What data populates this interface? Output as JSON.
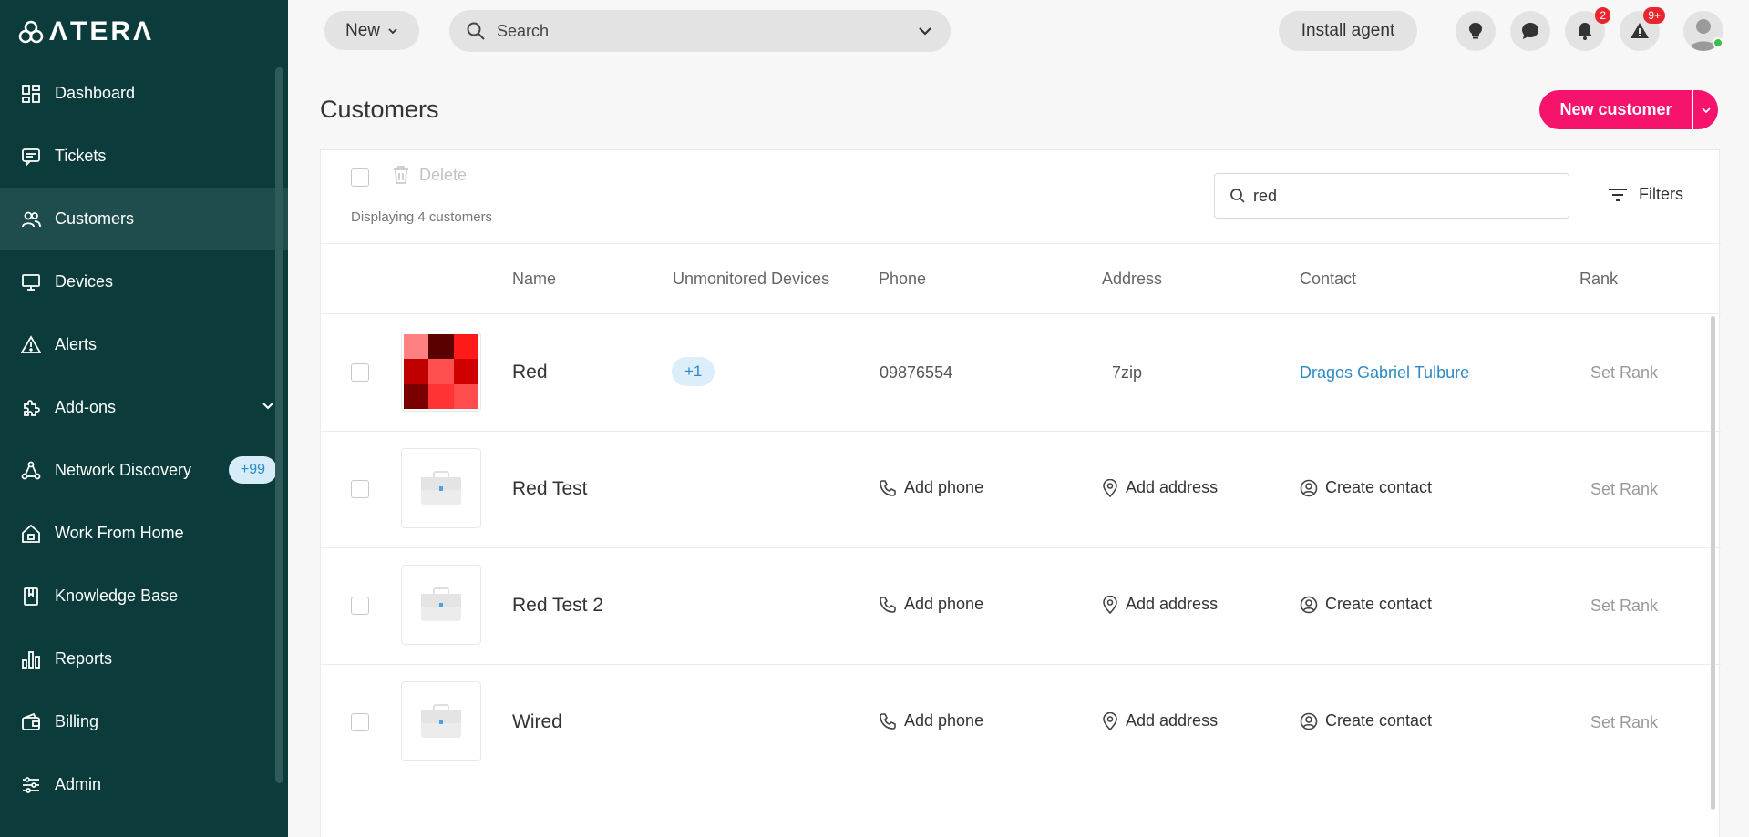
{
  "brand": {
    "logo_text": "ΛTERΛ"
  },
  "sidebar": {
    "items": [
      {
        "label": "Dashboard",
        "icon": "dashboard-icon"
      },
      {
        "label": "Tickets",
        "icon": "ticket-icon"
      },
      {
        "label": "Customers",
        "icon": "customers-icon",
        "active": true
      },
      {
        "label": "Devices",
        "icon": "monitor-icon"
      },
      {
        "label": "Alerts",
        "icon": "alert-icon"
      },
      {
        "label": "Add-ons",
        "icon": "puzzle-icon",
        "expandable": true
      },
      {
        "label": "Network Discovery",
        "icon": "network-icon",
        "badge": "+99"
      },
      {
        "label": "Work From Home",
        "icon": "home-icon"
      },
      {
        "label": "Knowledge Base",
        "icon": "book-icon"
      },
      {
        "label": "Reports",
        "icon": "bar-chart-icon"
      },
      {
        "label": "Billing",
        "icon": "wallet-icon"
      },
      {
        "label": "Admin",
        "icon": "sliders-icon"
      }
    ]
  },
  "topbar": {
    "new_label": "New",
    "search_label": "Search",
    "install_label": "Install agent",
    "notifications_count": "2",
    "alerts_count": "9+"
  },
  "page": {
    "title": "Customers",
    "new_customer_label": "New customer"
  },
  "toolbar": {
    "delete_label": "Delete",
    "displaying_text": "Displaying 4 customers",
    "search_value": "red",
    "filters_label": "Filters"
  },
  "table": {
    "columns": [
      "Name",
      "Unmonitored Devices",
      "Phone",
      "Address",
      "Contact",
      "Rank"
    ],
    "rows": [
      {
        "name": "Red",
        "unmonitored": "+1",
        "phone": "09876554",
        "address": "7zip",
        "contact": "Dragos Gabriel Tulbure",
        "rank": "Set Rank",
        "has_logo": true
      },
      {
        "name": "Red Test",
        "unmonitored": "",
        "phone": "Add phone",
        "address": "Add address",
        "contact": "Create contact",
        "rank": "Set Rank",
        "has_logo": false
      },
      {
        "name": "Red Test 2",
        "unmonitored": "",
        "phone": "Add phone",
        "address": "Add address",
        "contact": "Create contact",
        "rank": "Set Rank",
        "has_logo": false
      },
      {
        "name": "Wired",
        "unmonitored": "",
        "phone": "Add phone",
        "address": "Add address",
        "contact": "Create contact",
        "rank": "Set Rank",
        "has_logo": false
      }
    ]
  },
  "colors": {
    "sidebar_bg": "#0b3b3b",
    "sidebar_active": "#1f4d4d",
    "accent_pink": "#f5136b",
    "link_blue": "#2d8ac6",
    "badge_red": "#e8262d",
    "logo_tiles": [
      "#ff8080",
      "#5a0000",
      "#ff1a1a",
      "#c00000",
      "#ff5050",
      "#d00000",
      "#7a0000",
      "#ff3333",
      "#ff4d4d"
    ]
  }
}
